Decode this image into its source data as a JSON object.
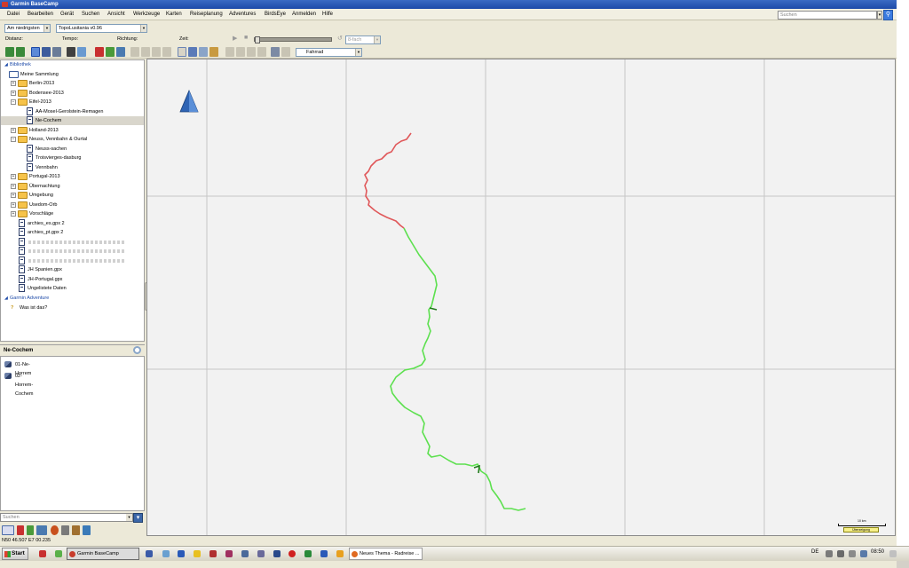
{
  "window": {
    "title": "Garmin BaseCamp"
  },
  "menu": [
    "Datei",
    "Bearbeiten",
    "Gerät",
    "Suchen",
    "Ansicht",
    "Werkzeuge",
    "Karten",
    "Reiseplanung",
    "Adventures",
    "BirdsEye",
    "Anmelden",
    "Hilfe"
  ],
  "top_search": {
    "placeholder": "Suchen"
  },
  "toolbar": {
    "detail_select": "Am niedrigsten",
    "map_select": "TopoLusitania v0.96",
    "distanz_label": "Distanz:",
    "tempo_label": "Tempo:",
    "richtung_label": "Richtung:",
    "zeit_label": "Zeit:",
    "speed_select": "8-fach",
    "profile_select": "Fahrrad"
  },
  "library": {
    "root_label": "Bibliothek",
    "collection_label": "Meine Sammlung",
    "items": [
      {
        "label": "Berlin-2013",
        "type": "folder",
        "indent": 1,
        "expander": "+"
      },
      {
        "label": "Bodensee-2013",
        "type": "folder",
        "indent": 1,
        "expander": "+"
      },
      {
        "label": "Eifel-2013",
        "type": "folder",
        "indent": 1,
        "expander": "−"
      },
      {
        "label": "AA-Mosel-Gerolstein-Remagen",
        "type": "list",
        "indent": 2,
        "expander": ""
      },
      {
        "label": "Ne-Cochem",
        "type": "list",
        "indent": 2,
        "expander": "",
        "selected": true
      },
      {
        "label": "Holland-2013",
        "type": "folder",
        "indent": 1,
        "expander": "+"
      },
      {
        "label": "Neuss, Vennbahn & Ourtal",
        "type": "folder",
        "indent": 1,
        "expander": "−"
      },
      {
        "label": "Neuss-sachen",
        "type": "list",
        "indent": 2,
        "expander": ""
      },
      {
        "label": "Troisvierges-dasburg",
        "type": "list",
        "indent": 2,
        "expander": ""
      },
      {
        "label": "Vennbahn",
        "type": "list",
        "indent": 2,
        "expander": ""
      },
      {
        "label": "Portugal-2013",
        "type": "folder",
        "indent": 1,
        "expander": "+"
      },
      {
        "label": "Übernachtung",
        "type": "folder",
        "indent": 1,
        "expander": "+"
      },
      {
        "label": "Umgebung",
        "type": "folder",
        "indent": 1,
        "expander": "+"
      },
      {
        "label": "Usedom-Orb",
        "type": "folder",
        "indent": 1,
        "expander": "+"
      },
      {
        "label": "Vorschläge",
        "type": "folder",
        "indent": 1,
        "expander": "+"
      },
      {
        "label": "archies_es.gpx 2",
        "type": "list",
        "indent": 1,
        "expander": ""
      },
      {
        "label": "archies_pt.gpx 2",
        "type": "list",
        "indent": 1,
        "expander": ""
      },
      {
        "label": "",
        "type": "list",
        "indent": 1,
        "expander": "",
        "obscured": true
      },
      {
        "label": "",
        "type": "list",
        "indent": 1,
        "expander": "",
        "obscured": true
      },
      {
        "label": "",
        "type": "list",
        "indent": 1,
        "expander": "",
        "obscured": true
      },
      {
        "label": "JH Spanien.gpx",
        "type": "list",
        "indent": 1,
        "expander": ""
      },
      {
        "label": "JH-Portugal.gpx",
        "type": "list",
        "indent": 1,
        "expander": ""
      },
      {
        "label": "Ungelistete Daten",
        "type": "list",
        "indent": 1,
        "expander": ""
      }
    ],
    "adventure_label": "Garmin Adventure",
    "help_label": "Was ist das?"
  },
  "list_panel": {
    "title": "Ne-Cochem",
    "routes": [
      "01-Ne-Horrem",
      "02-Horrem-Cochem"
    ],
    "search_placeholder": "Suchen"
  },
  "status": {
    "coordinates": "N50 46.507 E7 00.235"
  },
  "map": {
    "scale_label": "10 km",
    "overzoom_label": "Überzeigung"
  },
  "taskbar": {
    "start_label": "Start",
    "apps": [
      "Garmin BaseCamp",
      "Neues Thema - Radreise ..."
    ],
    "language": "DE",
    "clock": "08:50"
  },
  "colors": {
    "track_red": "#e0585a",
    "track_green": "#5de04f",
    "grid": "#c6c6c6",
    "title_bar": "#2a5ab8"
  }
}
